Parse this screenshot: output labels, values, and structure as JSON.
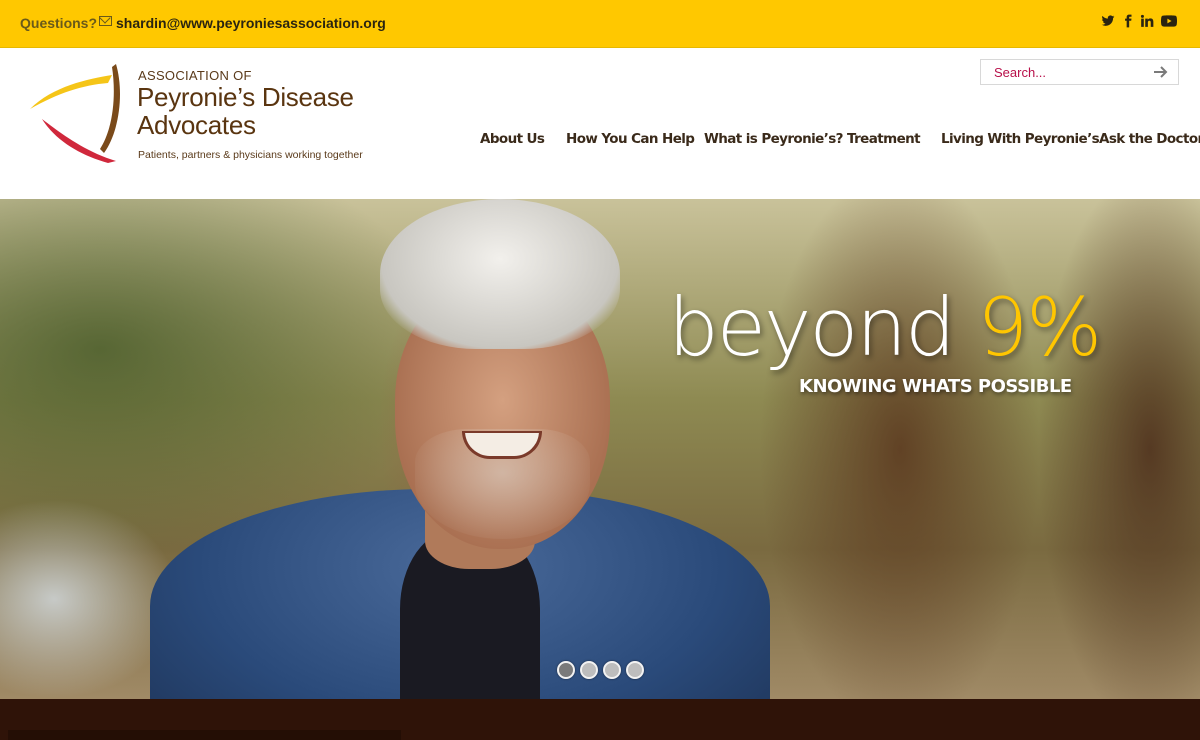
{
  "topbar": {
    "questions_label": "Questions?",
    "email": "shardin@www.peyroniesassociation.org",
    "background": "#ffc800",
    "social_icons": [
      "twitter-icon",
      "facebook-icon",
      "linkedin-icon",
      "youtube-icon"
    ]
  },
  "logo": {
    "line1": "ASSOCIATION OF",
    "line2": "Peyronie’s Disease",
    "line3": "Advocates",
    "tagline": "Patients, partners & physicians working together",
    "colors": [
      "#f5c518",
      "#d0283c",
      "#7a4a1a"
    ]
  },
  "search": {
    "placeholder": "Search..."
  },
  "nav": {
    "items": [
      "About Us",
      "How You Can Help",
      "What is Peyronie’s?",
      "Treatment",
      "Living With Peyronie’s",
      "Ask the Doctor"
    ]
  },
  "hero": {
    "headline_word": "beyond",
    "headline_accent": "9%",
    "subheadline": "KNOWING WHATS POSSIBLE",
    "accent_color": "#ffc600",
    "slides": 4,
    "active_slide": 1
  }
}
